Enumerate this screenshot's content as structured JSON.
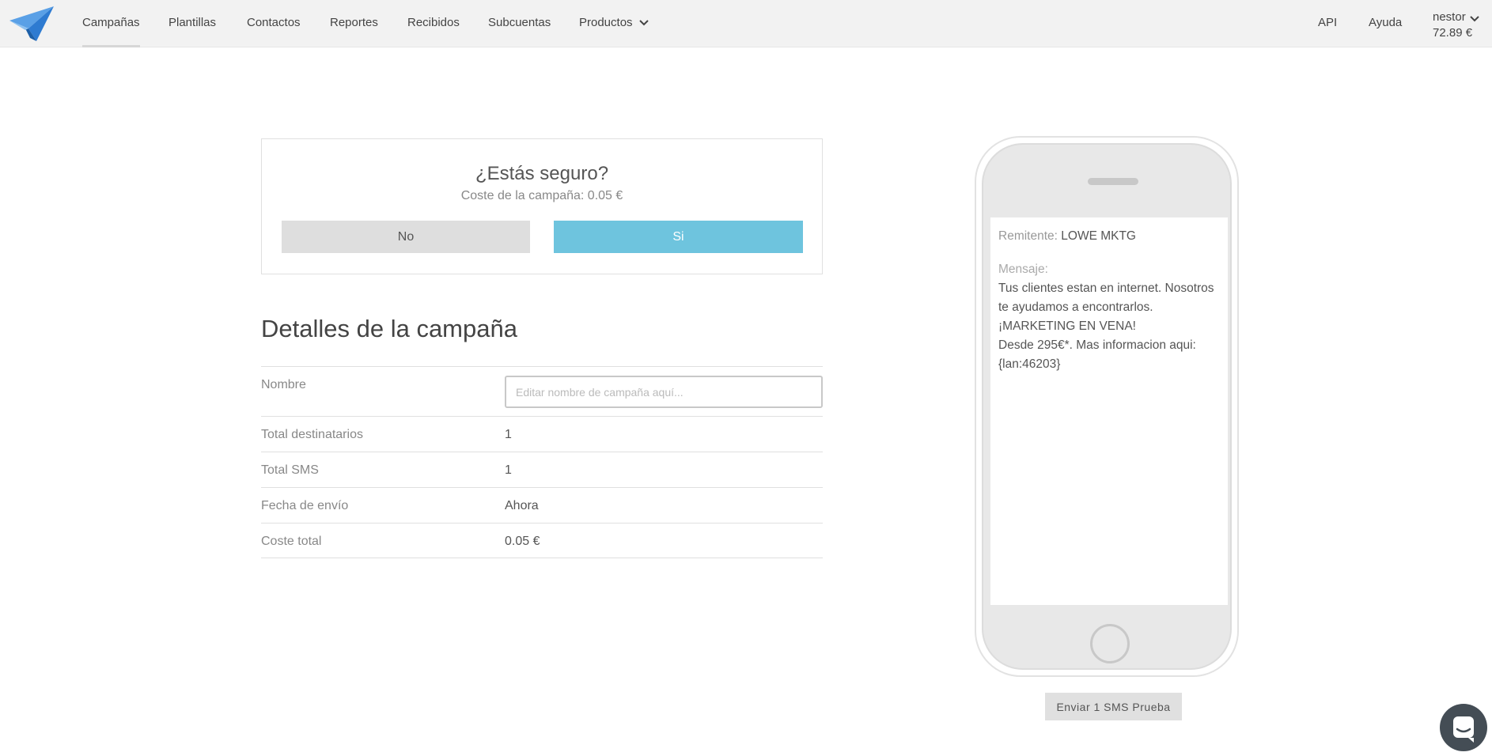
{
  "nav": {
    "items": [
      {
        "label": "Campañas"
      },
      {
        "label": "Plantillas"
      },
      {
        "label": "Contactos"
      },
      {
        "label": "Reportes"
      },
      {
        "label": "Recibidos"
      },
      {
        "label": "Subcuentas"
      },
      {
        "label": "Productos"
      }
    ],
    "api": "API",
    "help": "Ayuda",
    "user": {
      "name": "nestor",
      "balance": "72.89 €"
    }
  },
  "confirm": {
    "title": "¿Estás seguro?",
    "cost": "Coste de la campaña: 0.05 €",
    "no_label": "No",
    "yes_label": "Si"
  },
  "details": {
    "title": "Detalles de la campaña",
    "name_label": "Nombre",
    "name_placeholder": "Editar nombre de campaña aquí...",
    "rows": [
      {
        "label": "Total destinatarios",
        "value": "1"
      },
      {
        "label": "Total SMS",
        "value": "1"
      },
      {
        "label": "Fecha de envío",
        "value": "Ahora"
      },
      {
        "label": "Coste total",
        "value": "0.05 €"
      }
    ]
  },
  "phone": {
    "sender_label": "Remitente:",
    "sender_value": "LOWE MKTG",
    "message_label": "Mensaje:",
    "message_text": "Tus clientes estan en internet. Nosotros te ayudamos a encontrarlos. ¡MARKETING EN VENA!\nDesde 295€*. Mas informacion aqui: {lan:46203}"
  },
  "test_button": "Enviar 1 SMS Prueba",
  "colors": {
    "accent": "#6ec4de",
    "navbar": "#f2f2f2",
    "logo_blue": "#2e7bd1"
  },
  "icons": {
    "logo": "paper-plane-icon",
    "dropdown": "chevron-down-icon",
    "chat": "chat-icon"
  }
}
